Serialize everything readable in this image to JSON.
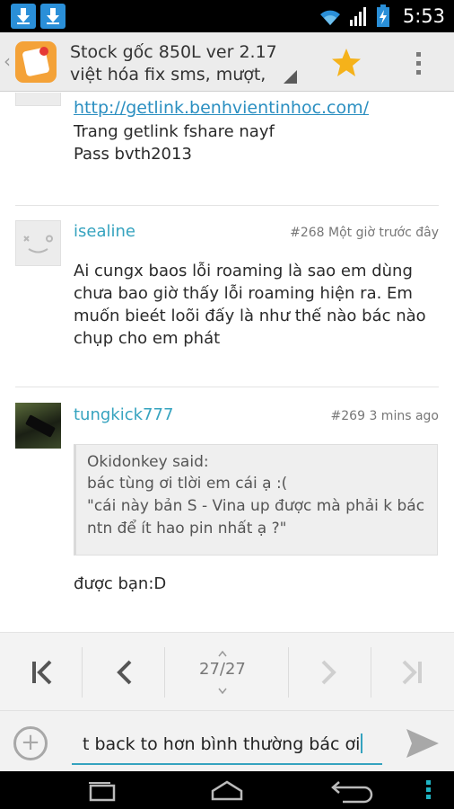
{
  "status_bar": {
    "time": "5:53",
    "icons": [
      "download-icon",
      "download-icon",
      "wifi-icon",
      "signal-icon",
      "battery-charging-icon"
    ]
  },
  "action_bar": {
    "title_line1": "Stock gốc 850L ver 2.17",
    "title_line2": "việt hóa fix sms, mượt,",
    "icons": [
      "up-caret-icon",
      "app-icon",
      "star-icon",
      "overflow-menu-icon"
    ],
    "colors": {
      "star": "#f5b21a",
      "app_icon": "#f4a238"
    }
  },
  "posts": [
    {
      "partial": true,
      "link": "http://getlink.benhvientinhoc.com/",
      "lines": [
        "Trang getlink fshare nayf",
        "Pass bvth2013"
      ]
    },
    {
      "username": "isealine",
      "number": "#268",
      "time": "Một giờ trước đây",
      "avatar": "default-smiley-avatar",
      "lines": [
        "Ai cungx baos lỗi roaming là sao em dùng",
        "chưa bao giờ thấy lỗi roaming hiện ra. Em",
        "muốn bieét loõi đấy là như thế nào bác nào",
        "chụp cho em phát"
      ]
    },
    {
      "username": "tungkick777",
      "number": "#269",
      "time": "3 mins ago",
      "avatar": "photo-avatar",
      "quote": {
        "author_line": "Okidonkey said:",
        "lines": [
          "bác tùng ơi tlời em cái ạ :(",
          "\"cái này bản S - Vina up được mà phải k bác",
          "ntn để ít hao pin nhất ạ ?\""
        ]
      },
      "reply": "được bạn:D"
    }
  ],
  "pager": {
    "page_indicator": "27/27",
    "current_page": 27,
    "total_pages": 27,
    "icons": [
      "first-page-icon",
      "prev-page-icon",
      "next-page-icon",
      "last-page-icon"
    ]
  },
  "compose": {
    "value": "t back to hơn bình thường bác ơi",
    "icons": [
      "add-icon",
      "send-icon"
    ],
    "accent": "#35a3bf"
  },
  "nav_bar": {
    "icons": [
      "recent-apps-icon",
      "home-icon",
      "back-icon",
      "menu-dots-icon"
    ],
    "accent": "#1fb4c4"
  }
}
